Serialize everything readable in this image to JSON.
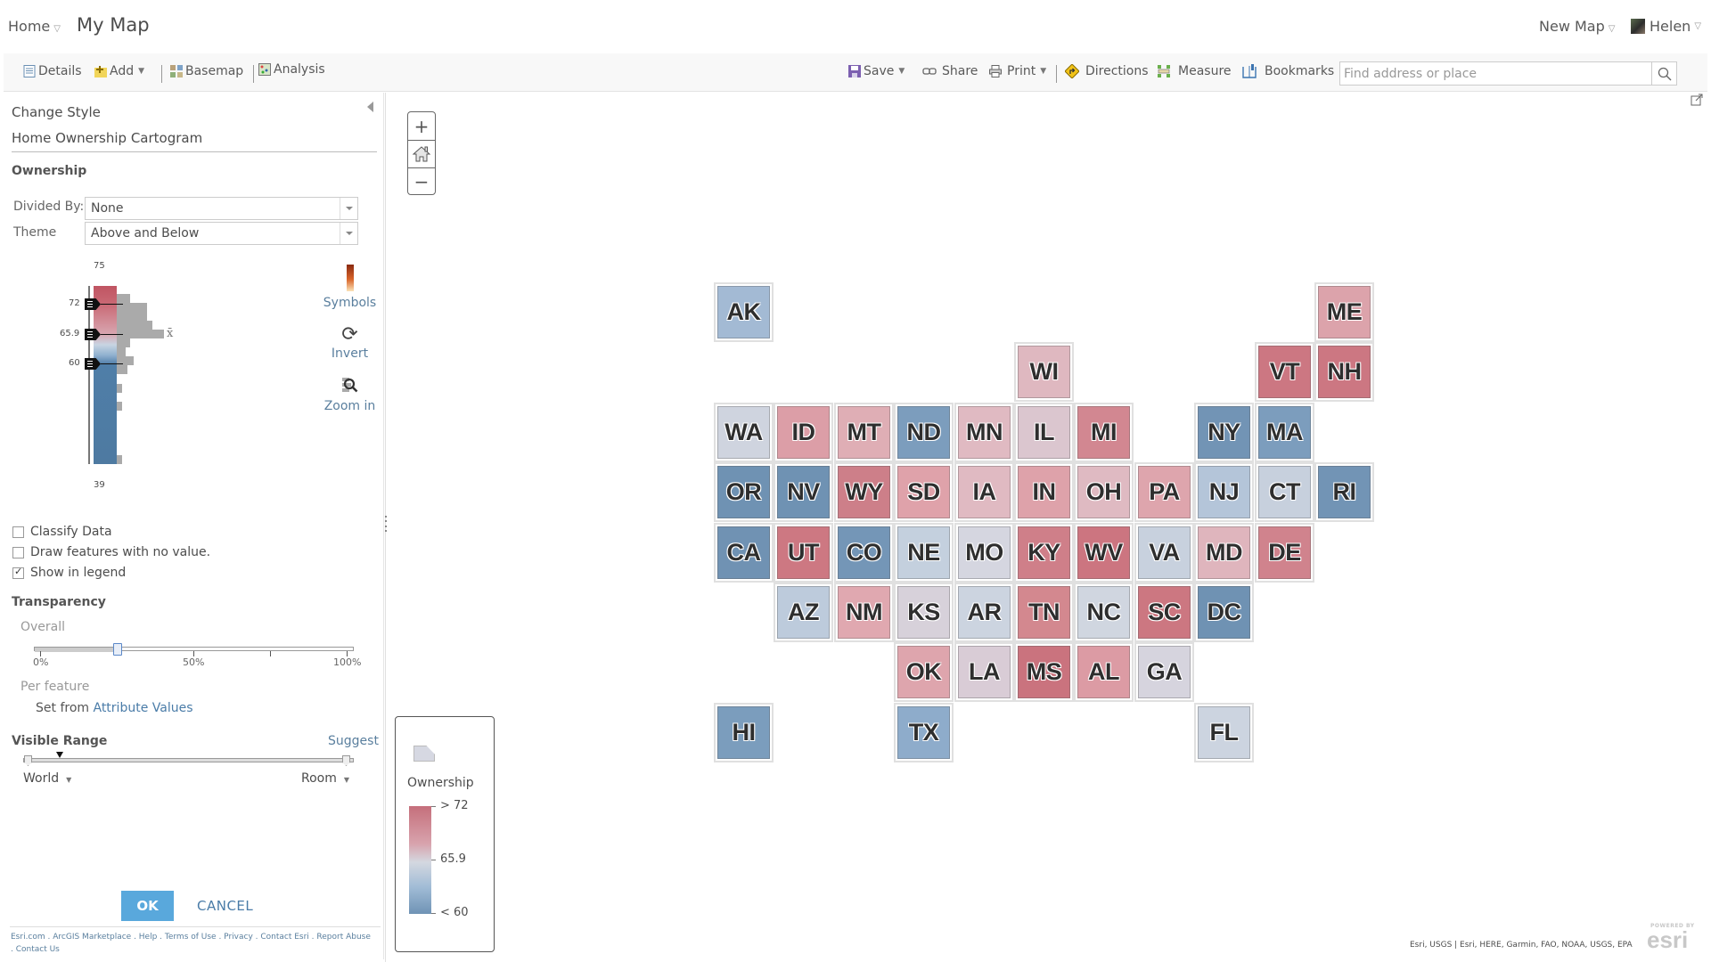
{
  "header": {
    "home_label": "Home",
    "map_title": "My Map",
    "new_map_label": "New Map",
    "user_name": "Helen"
  },
  "toolbar": {
    "details": "Details",
    "add": "Add",
    "basemap": "Basemap",
    "analysis": "Analysis",
    "save": "Save",
    "share": "Share",
    "print": "Print",
    "directions": "Directions",
    "measure": "Measure",
    "bookmarks": "Bookmarks",
    "search_placeholder": "Find address or place"
  },
  "panel": {
    "heading": "Change Style",
    "layer_name": "Home Ownership Cartogram",
    "attribute": "Ownership",
    "divided_by_label": "Divided By:",
    "divided_by_value": "None",
    "theme_label": "Theme",
    "theme_value": "Above and Below",
    "histogram": {
      "max": "75",
      "min": "39",
      "handles": [
        "72",
        "65.9",
        "60"
      ],
      "mean_symbol": "x̄"
    },
    "tools": {
      "symbols": "Symbols",
      "invert": "Invert",
      "zoom_in": "Zoom in"
    },
    "checkboxes": [
      {
        "label": "Classify Data",
        "checked": false
      },
      {
        "label": "Draw features with no value.",
        "checked": false
      },
      {
        "label": "Show in legend",
        "checked": true
      }
    ],
    "transparency": {
      "heading": "Transparency",
      "overall_label": "Overall",
      "value_percent": 25,
      "ticks": [
        "0%",
        "50%",
        "100%"
      ],
      "per_feature_label": "Per feature",
      "set_from_prefix": "Set from",
      "set_from_link": "Attribute Values"
    },
    "visible_range": {
      "heading": "Visible Range",
      "suggest": "Suggest",
      "min_scale": "World",
      "max_scale": "Room"
    },
    "ok": "OK",
    "cancel": "CANCEL",
    "footer_links": "Esri.com . ArcGIS Marketplace . Help . Terms of Use . Privacy . Contact Esri . Report Abuse . Contact Us"
  },
  "legend": {
    "title": "Ownership",
    "high": "> 72",
    "mid": "65.9",
    "low": "< 60"
  },
  "map": {
    "attribution": "Esri, USGS | Esri, HERE, Garmin, FAO, NOAA, USGS, EPA",
    "logo_top": "POWERED BY",
    "logo_main": "esri",
    "tiles": [
      {
        "state": "AK",
        "col": 0,
        "row": 0,
        "color": "#a3bad4"
      },
      {
        "state": "ME",
        "col": 10,
        "row": 0,
        "color": "#dca3ab"
      },
      {
        "state": "WI",
        "col": 5,
        "row": 1,
        "color": "#dfb8c0"
      },
      {
        "state": "VT",
        "col": 9,
        "row": 1,
        "color": "#cc7782"
      },
      {
        "state": "NH",
        "col": 10,
        "row": 1,
        "color": "#cc7782"
      },
      {
        "state": "WA",
        "col": 0,
        "row": 2,
        "color": "#cfd4df"
      },
      {
        "state": "ID",
        "col": 1,
        "row": 2,
        "color": "#dc9ea7"
      },
      {
        "state": "MT",
        "col": 2,
        "row": 2,
        "color": "#dfaeb5"
      },
      {
        "state": "ND",
        "col": 3,
        "row": 2,
        "color": "#7c9dbd"
      },
      {
        "state": "MN",
        "col": 4,
        "row": 2,
        "color": "#e0bac2"
      },
      {
        "state": "IL",
        "col": 5,
        "row": 2,
        "color": "#dbc6cf"
      },
      {
        "state": "MI",
        "col": 6,
        "row": 2,
        "color": "#d28791"
      },
      {
        "state": "NY",
        "col": 8,
        "row": 2,
        "color": "#7294b5"
      },
      {
        "state": "MA",
        "col": 9,
        "row": 2,
        "color": "#7c9dbd"
      },
      {
        "state": "OR",
        "col": 0,
        "row": 3,
        "color": "#6f92b3"
      },
      {
        "state": "NV",
        "col": 1,
        "row": 3,
        "color": "#6f92b3"
      },
      {
        "state": "WY",
        "col": 2,
        "row": 3,
        "color": "#cd7f89"
      },
      {
        "state": "SD",
        "col": 3,
        "row": 3,
        "color": "#dfa2aa"
      },
      {
        "state": "IA",
        "col": 4,
        "row": 3,
        "color": "#e0bac2"
      },
      {
        "state": "IN",
        "col": 5,
        "row": 3,
        "color": "#dea2aa"
      },
      {
        "state": "OH",
        "col": 6,
        "row": 3,
        "color": "#dfbac2"
      },
      {
        "state": "PA",
        "col": 7,
        "row": 3,
        "color": "#dea5ad"
      },
      {
        "state": "NJ",
        "col": 8,
        "row": 3,
        "color": "#b4c5d9"
      },
      {
        "state": "CT",
        "col": 9,
        "row": 3,
        "color": "#c7d0dd"
      },
      {
        "state": "RI",
        "col": 10,
        "row": 3,
        "color": "#7294b5"
      },
      {
        "state": "CA",
        "col": 0,
        "row": 4,
        "color": "#7092b3"
      },
      {
        "state": "UT",
        "col": 1,
        "row": 4,
        "color": "#cd7882"
      },
      {
        "state": "CO",
        "col": 2,
        "row": 4,
        "color": "#7496b7"
      },
      {
        "state": "NE",
        "col": 3,
        "row": 4,
        "color": "#c4d0de"
      },
      {
        "state": "MO",
        "col": 4,
        "row": 4,
        "color": "#d5d6e0"
      },
      {
        "state": "KY",
        "col": 5,
        "row": 4,
        "color": "#cf7f89"
      },
      {
        "state": "WV",
        "col": 6,
        "row": 4,
        "color": "#cc7580"
      },
      {
        "state": "VA",
        "col": 7,
        "row": 4,
        "color": "#c8d1de"
      },
      {
        "state": "MD",
        "col": 8,
        "row": 4,
        "color": "#dfb5bd"
      },
      {
        "state": "DE",
        "col": 9,
        "row": 4,
        "color": "#d0838d"
      },
      {
        "state": "AZ",
        "col": 1,
        "row": 5,
        "color": "#bdcbdc"
      },
      {
        "state": "NM",
        "col": 2,
        "row": 5,
        "color": "#e0a8b0"
      },
      {
        "state": "KS",
        "col": 3,
        "row": 5,
        "color": "#d7d1da"
      },
      {
        "state": "AR",
        "col": 4,
        "row": 5,
        "color": "#ccd4e0"
      },
      {
        "state": "TN",
        "col": 5,
        "row": 5,
        "color": "#d3888f"
      },
      {
        "state": "NC",
        "col": 6,
        "row": 5,
        "color": "#d0d6e0"
      },
      {
        "state": "SC",
        "col": 7,
        "row": 5,
        "color": "#cc7781"
      },
      {
        "state": "DC",
        "col": 8,
        "row": 5,
        "color": "#6f92b3"
      },
      {
        "state": "OK",
        "col": 3,
        "row": 6,
        "color": "#dea5ad"
      },
      {
        "state": "LA",
        "col": 4,
        "row": 6,
        "color": "#d9ccd6"
      },
      {
        "state": "MS",
        "col": 5,
        "row": 6,
        "color": "#ca737e"
      },
      {
        "state": "AL",
        "col": 6,
        "row": 6,
        "color": "#dc9ba4"
      },
      {
        "state": "GA",
        "col": 7,
        "row": 6,
        "color": "#d6d4de"
      },
      {
        "state": "HI",
        "col": 0,
        "row": 7,
        "color": "#7b9dbd"
      },
      {
        "state": "TX",
        "col": 3,
        "row": 7,
        "color": "#8eaccb"
      },
      {
        "state": "FL",
        "col": 8,
        "row": 7,
        "color": "#ccd4e0"
      }
    ]
  }
}
